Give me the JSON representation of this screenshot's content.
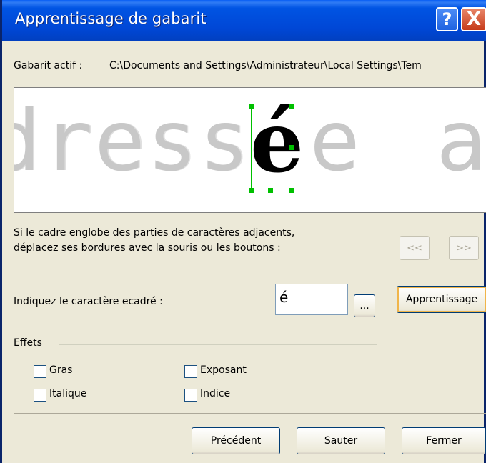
{
  "window": {
    "title": "Apprentissage de gabarit",
    "help_label": "?",
    "close_label": "X"
  },
  "template": {
    "label": "Gabarit actif :",
    "path": "C:\\Documents and Settings\\Administrateur\\Local Settings\\Tem"
  },
  "preview": {
    "text_before": "dress",
    "selected_char": "é",
    "text_after": "e",
    "text_far": "a:"
  },
  "instructions": {
    "line1": "Si le cadre englobe des parties de caractères adjacents,",
    "line2": "déplacez ses bordures avec la souris ou les boutons :"
  },
  "nav": {
    "prev": "<<",
    "next": ">>"
  },
  "char_field": {
    "label": "Indiquez le caractère ecadré :",
    "value": "é",
    "browse_label": "...",
    "learn_label": "Apprentissage"
  },
  "effects": {
    "title": "Effets",
    "bold": "Gras",
    "italic": "Italique",
    "superscript": "Exposant",
    "subscript": "Indice"
  },
  "buttons": {
    "previous": "Précédent",
    "skip": "Sauter",
    "close": "Fermer"
  }
}
